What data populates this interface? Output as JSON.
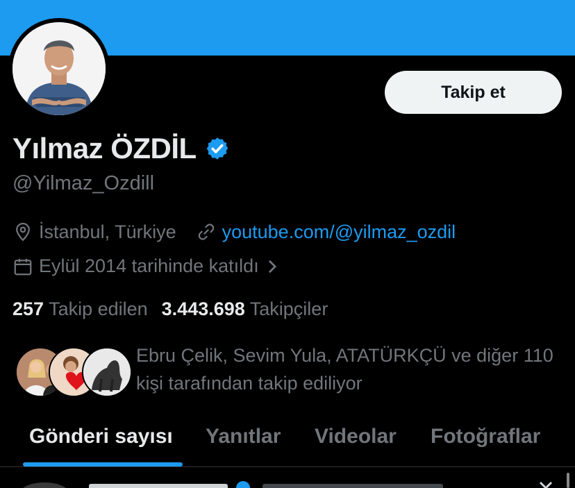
{
  "profile": {
    "display_name": "Yılmaz ÖZDİL",
    "handle": "@Yilmaz_Ozdill",
    "location": "İstanbul, Türkiye",
    "website": "youtube.com/@yilmaz_ozdil",
    "joined": "Eylül 2014 tarihinde katıldı",
    "verified_icon": "verified-badge-icon"
  },
  "actions": {
    "follow_label": "Takip et"
  },
  "stats": {
    "following_count": "257",
    "following_label": "Takip edilen",
    "followers_count": "3.443.698",
    "followers_label": "Takipçiler"
  },
  "followed_by": {
    "text": "Ebru Çelik, Sevim Yula, ATATÜRKÇÜ ve diğer 110 kişi tarafından takip ediliyor"
  },
  "tabs": [
    {
      "label": "Gönderi sayısı",
      "active": true
    },
    {
      "label": "Yanıtlar",
      "active": false
    },
    {
      "label": "Videolar",
      "active": false
    },
    {
      "label": "Fotoğraflar",
      "active": false
    }
  ],
  "colors": {
    "accent": "#1d9bf0",
    "background": "#000000",
    "text_primary": "#e7e9ea",
    "text_secondary": "#71767b",
    "button_bg": "#eff3f4"
  }
}
